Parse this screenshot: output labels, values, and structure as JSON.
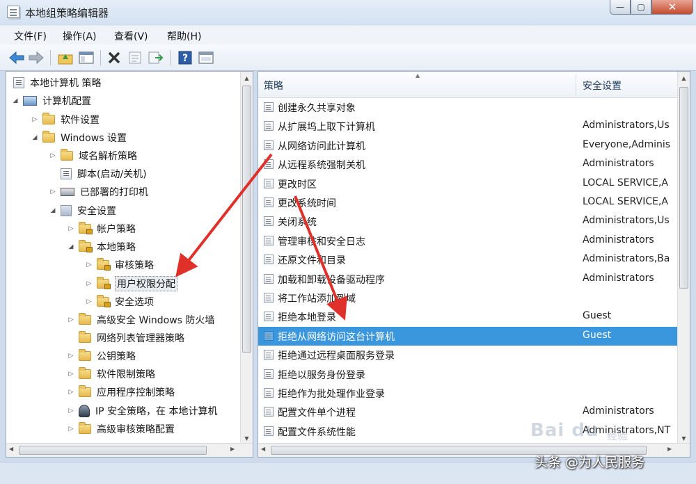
{
  "window": {
    "title": "本地组策略编辑器"
  },
  "window_buttons": {
    "minimize": "—",
    "maximize": "▢",
    "close": "✕"
  },
  "menu": [
    {
      "label": "文件(F)"
    },
    {
      "label": "操作(A)"
    },
    {
      "label": "查看(V)"
    },
    {
      "label": "帮助(H)"
    }
  ],
  "toolbar": {
    "icons": [
      "back-arrow-icon",
      "forward-arrow-icon",
      "up-folder-icon",
      "show-hide-tree-icon",
      "delete-icon",
      "properties-icon",
      "export-list-icon",
      "help-icon",
      "console-icon"
    ]
  },
  "tree": {
    "root": "本地计算机 策略",
    "computer_config": "计算机配置",
    "software_settings": "软件设置",
    "windows_settings": "Windows 设置",
    "name_resolution": "域名解析策略",
    "scripts": "脚本(启动/关机)",
    "printers": "已部署的打印机",
    "security_settings": "安全设置",
    "account_policy": "帐户策略",
    "local_policy": "本地策略",
    "audit_policy": "审核策略",
    "user_rights": "用户权限分配",
    "security_options": "安全选项",
    "firewall": "高级安全 Windows 防火墙",
    "network_list": "网络列表管理器策略",
    "public_key": "公钥策略",
    "software_restriction": "软件限制策略",
    "app_control": "应用程序控制策略",
    "ip_security": "IP 安全策略，在 本地计算机",
    "advanced_audit": "高级审核策略配置"
  },
  "list": {
    "col_policy": "策略",
    "col_setting": "安全设置",
    "rows": [
      {
        "policy": "创建永久共享对象",
        "setting": ""
      },
      {
        "policy": "从扩展坞上取下计算机",
        "setting": "Administrators,Us"
      },
      {
        "policy": "从网络访问此计算机",
        "setting": "Everyone,Adminis"
      },
      {
        "policy": "从远程系统强制关机",
        "setting": "Administrators"
      },
      {
        "policy": "更改时区",
        "setting": "LOCAL SERVICE,A"
      },
      {
        "policy": "更改系统时间",
        "setting": "LOCAL SERVICE,A"
      },
      {
        "policy": "关闭系统",
        "setting": "Administrators,Us"
      },
      {
        "policy": "管理审核和安全日志",
        "setting": "Administrators"
      },
      {
        "policy": "还原文件和目录",
        "setting": "Administrators,Ba"
      },
      {
        "policy": "加载和卸载设备驱动程序",
        "setting": "Administrators"
      },
      {
        "policy": "将工作站添加到域",
        "setting": ""
      },
      {
        "policy": "拒绝本地登录",
        "setting": "Guest"
      },
      {
        "policy": "拒绝从网络访问这台计算机",
        "setting": "Guest"
      },
      {
        "policy": "拒绝通过远程桌面服务登录",
        "setting": ""
      },
      {
        "policy": "拒绝以服务身份登录",
        "setting": ""
      },
      {
        "policy": "拒绝作为批处理作业登录",
        "setting": ""
      },
      {
        "policy": "配置文件单个进程",
        "setting": "Administrators"
      },
      {
        "policy": "配置文件系统性能",
        "setting": "Administrators,NT"
      }
    ],
    "selected_index": 12
  },
  "colors": {
    "selection": "#3a96dd",
    "annotation_arrow": "#e0302a"
  },
  "watermarks": {
    "baidu": "Bai du",
    "jingyan": "经验",
    "toutiao": "头条 @为人民服务"
  }
}
